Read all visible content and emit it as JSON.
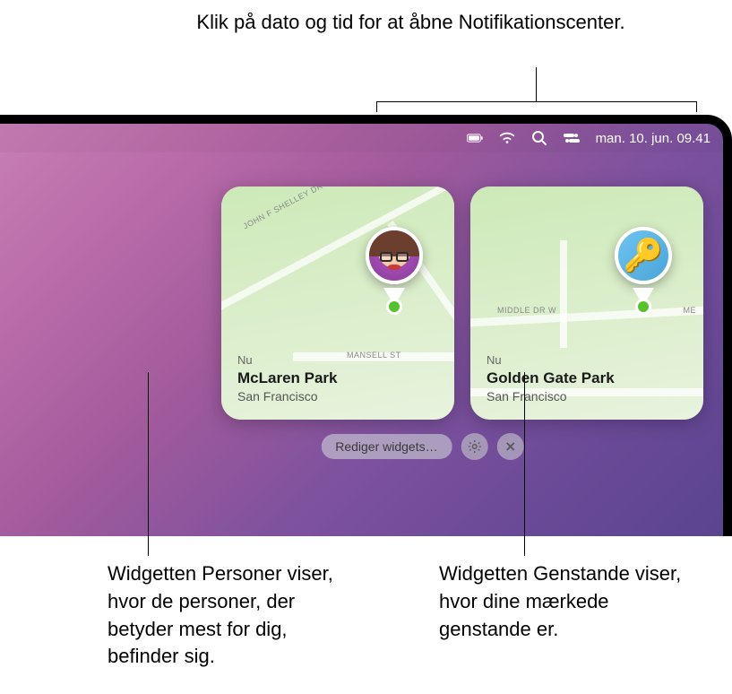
{
  "callouts": {
    "top": "Klik på dato og tid for at åbne Notifikationscenter.",
    "bottom_left": "Widgetten Personer viser, hvor de personer, der betyder mest for dig, befinder sig.",
    "bottom_right": "Widgetten Genstande viser, hvor dine mærkede genstande er."
  },
  "menubar": {
    "datetime": "man. 10. jun.  09.41",
    "icons": {
      "battery": "battery-icon",
      "wifi": "wifi-icon",
      "search": "search-icon",
      "control_center": "control-center-icon"
    }
  },
  "widgets": {
    "people": {
      "time_label": "Nu",
      "place": "McLaren Park",
      "city": "San Francisco",
      "roads": [
        "JOHN F SHELLEY DR",
        "MANSELL ST"
      ]
    },
    "items": {
      "time_label": "Nu",
      "place": "Golden Gate Park",
      "city": "San Francisco",
      "roads": [
        "MIDDLE DR W",
        "ME"
      ]
    }
  },
  "controls": {
    "edit_widgets": "Rediger widgets…"
  }
}
